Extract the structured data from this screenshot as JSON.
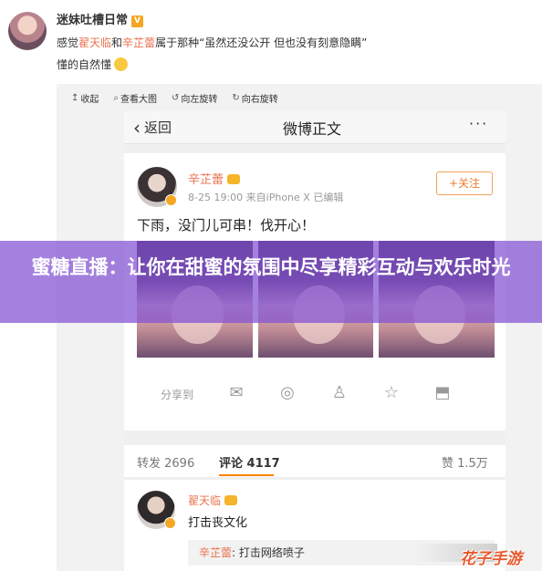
{
  "top_post": {
    "username": "迷妹吐槽日常",
    "verified_badge": "V",
    "line1_prefix": "感觉",
    "line1_mention1": "翟天临",
    "line1_and": "和",
    "line1_mention2": "辛芷蕾",
    "line1_suffix": "属于那种“虽然还没公开 但也没有刻意隐瞒”",
    "line2": "懂的自然懂"
  },
  "viewer_toolbar": {
    "collapse": "收起",
    "view_large": "查看大图",
    "rotate_left": "向左旋转",
    "rotate_right": "向右旋转"
  },
  "phone": {
    "back_label": "返回",
    "nav_title": "微博正文",
    "more": "···",
    "post": {
      "author": "辛芷蕾",
      "meta": "8-25 19:00  来自iPhone X  已编辑",
      "follow_label": "+关注",
      "text": "下雨，没门儿可串！伐开心！"
    },
    "share": {
      "label": "分享到",
      "icons": [
        "wechat-icon",
        "moments-icon",
        "qq-icon",
        "qzone-icon",
        "save-image-icon"
      ]
    },
    "stats": {
      "repost": "转发 2696",
      "comment": "评论 4117",
      "like": "赞 1.5万"
    },
    "comment": {
      "author": "翟天临",
      "text": "打击丧文化",
      "reply_name": "辛芷蕾",
      "reply_text": ": 打击网络喷子"
    }
  },
  "banner": {
    "text": "蜜糖直播：让你在甜蜜的氛围中尽享精彩互动与欢乐时光"
  },
  "watermark": "花子手游",
  "colors": {
    "mention": "#eb7350",
    "banner_bg": "#8250d2",
    "follow_border": "#f0a35c",
    "tab_underline": "#ff8200"
  }
}
